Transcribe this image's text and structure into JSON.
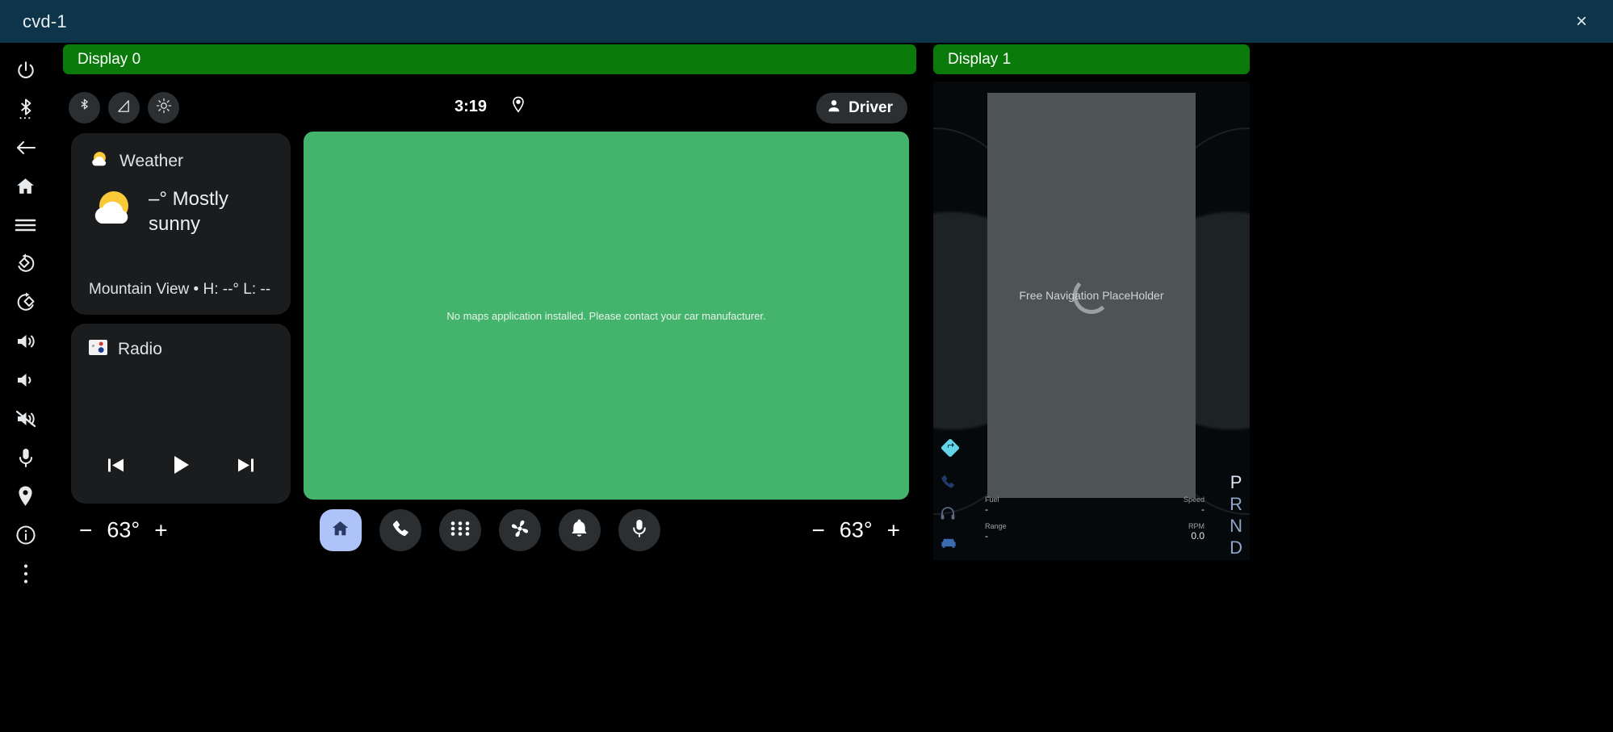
{
  "window": {
    "title": "cvd-1",
    "close_label": "×"
  },
  "sidebar": {
    "items": [
      {
        "name": "power-icon",
        "label": "Power"
      },
      {
        "name": "bluetooth-icon",
        "label": "Bluetooth"
      },
      {
        "name": "back-arrow-icon",
        "label": "Back"
      },
      {
        "name": "home-icon",
        "label": "Home"
      },
      {
        "name": "menu-icon",
        "label": "Menu"
      },
      {
        "name": "rotate-left-icon",
        "label": "Rotate left"
      },
      {
        "name": "rotate-right-icon",
        "label": "Rotate right"
      },
      {
        "name": "volume-up-icon",
        "label": "Volume up"
      },
      {
        "name": "volume-down-icon",
        "label": "Volume down"
      },
      {
        "name": "volume-mute-icon",
        "label": "Mute"
      },
      {
        "name": "microphone-icon",
        "label": "Microphone"
      },
      {
        "name": "location-pin-icon",
        "label": "Location"
      },
      {
        "name": "info-icon",
        "label": "Info"
      },
      {
        "name": "more-vertical-icon",
        "label": "More"
      }
    ]
  },
  "display0": {
    "header": "Display 0",
    "statusbar": {
      "clock": "3:19",
      "quick_toggles": [
        "bluetooth-icon",
        "signal-cellular-icon",
        "brightness-icon"
      ],
      "location_icon": "location-pin-icon",
      "profile": "Driver"
    },
    "weather": {
      "title": "Weather",
      "condition": "–° Mostly sunny",
      "footer": "Mountain View • H: --° L: --"
    },
    "radio": {
      "title": "Radio",
      "controls": [
        "skip-previous-icon",
        "play-icon",
        "skip-next-icon"
      ]
    },
    "map": {
      "message": "No maps application installed. Please contact your car manufacturer."
    },
    "climate": {
      "left_temp": "63°",
      "right_temp": "63°",
      "minus": "−",
      "plus": "+"
    },
    "navbar": [
      {
        "name": "home-icon",
        "label": "Home",
        "active": true
      },
      {
        "name": "phone-icon",
        "label": "Dialer",
        "active": false
      },
      {
        "name": "apps-grid-icon",
        "label": "App grid",
        "active": false
      },
      {
        "name": "fan-icon",
        "label": "Climate",
        "active": false
      },
      {
        "name": "bell-icon",
        "label": "Notifications",
        "active": false
      },
      {
        "name": "microphone-icon",
        "label": "Assistant",
        "active": false
      }
    ]
  },
  "display1": {
    "header": "Display 1",
    "nav_placeholder": "Free Navigation PlaceHolder",
    "gears": [
      "P",
      "R",
      "N",
      "D"
    ],
    "selected_gear": "P",
    "telemetry": [
      {
        "key": "Fuel",
        "value": "-",
        "key2": "Speed",
        "value2": "-"
      },
      {
        "key": "Range",
        "value": "-",
        "key2": "RPM",
        "value2": "0.0"
      }
    ],
    "side_icons": [
      "navigation-arrow-icon",
      "phone-icon",
      "headphones-icon",
      "car-icon"
    ]
  },
  "colors": {
    "title_bar": "#0d3448",
    "panel_header_green": "#0a7a0a",
    "map_green": "#44b36b",
    "card_bg": "#1b1c1e",
    "accent_blue": "#aec3f7"
  }
}
